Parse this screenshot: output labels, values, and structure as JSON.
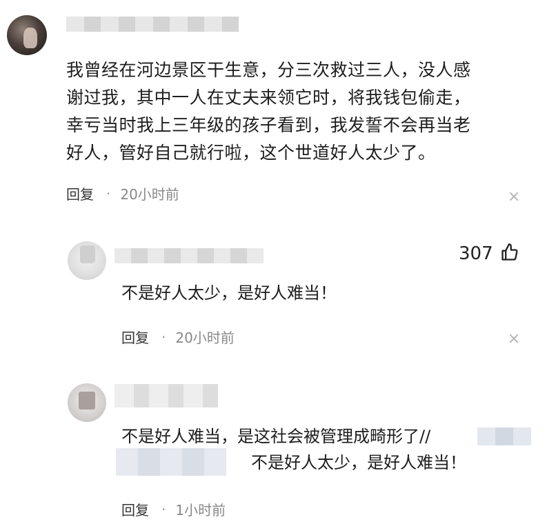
{
  "comment": {
    "lines": [
      "我曾经在河边景区干生意，分三次救过三人，没人感",
      "谢过我，其中一人在丈夫来领它时，将我钱包偷走，",
      "幸亏当时我上三年级的孩子看到，我发誓不会再当老",
      "好人，管好自己就行啦，这个世道好人太少了。"
    ],
    "reply_label": "回复",
    "separator": "·",
    "time": "20小时前"
  },
  "reply1": {
    "likes": "307",
    "text": "不是好人太少，是好人难当！",
    "reply_label": "回复",
    "separator": "·",
    "time": "20小时前"
  },
  "reply2": {
    "text_line1": "不是好人难当，是这社会被管理成畸形了//",
    "text_line2": "不是好人太少，是好人难当！",
    "reply_label": "回复",
    "separator": "·",
    "time": "1小时前"
  },
  "icons": {
    "like": "thumbs-up-icon",
    "close": "close-icon"
  }
}
